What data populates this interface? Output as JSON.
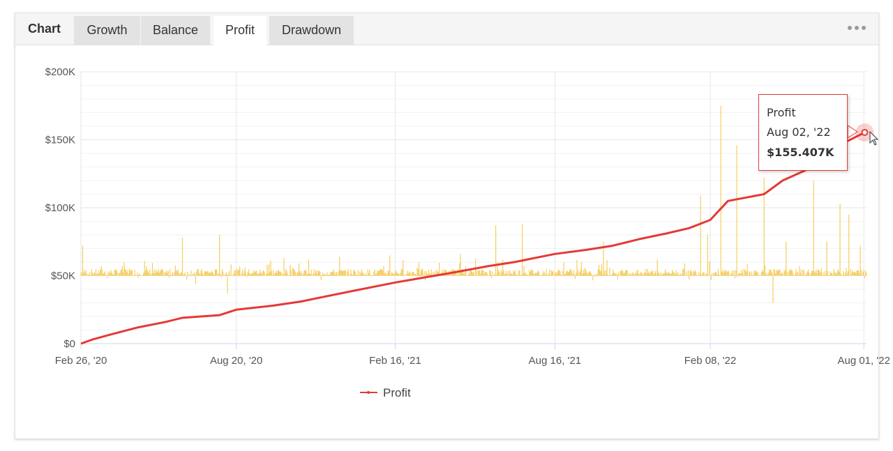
{
  "header": {
    "chart_label": "Chart",
    "tabs": [
      {
        "label": "Growth",
        "active": false
      },
      {
        "label": "Balance",
        "active": false
      },
      {
        "label": "Profit",
        "active": true
      },
      {
        "label": "Drawdown",
        "active": false
      }
    ],
    "menu_icon": "more-dots-icon"
  },
  "tooltip": {
    "series": "Profit",
    "date": "Aug 02, '22",
    "value": "$155.407K"
  },
  "colors": {
    "profit_line": "#e53935",
    "bars": "#f5cd5d",
    "grid": "#e6e6e6",
    "axis": "#ccd6eb",
    "tooltip_border": "#e53935"
  },
  "chart_data": {
    "type": "line",
    "y_tick_labels": [
      "$0",
      "$50K",
      "$100K",
      "$150K",
      "$200K"
    ],
    "x_tick_labels": [
      "Feb 26, '20",
      "Aug 20, '20",
      "Feb 16, '21",
      "Aug 16, '21",
      "Feb 08, '22",
      "Aug 01, '22"
    ],
    "x_range": [
      "2020-02-26",
      "2022-08-04"
    ],
    "ylim": [
      0,
      200000
    ],
    "grid": true,
    "legend": {
      "position": "bottom-center",
      "entries": [
        "Profit"
      ]
    },
    "series": [
      {
        "name": "Profit",
        "type": "line",
        "points": [
          [
            "2020-02-26",
            0
          ],
          [
            "2020-03-10",
            3000
          ],
          [
            "2020-04-01",
            7000
          ],
          [
            "2020-05-01",
            12000
          ],
          [
            "2020-06-01",
            16000
          ],
          [
            "2020-06-20",
            19000
          ],
          [
            "2020-08-01",
            21000
          ],
          [
            "2020-08-20",
            25000
          ],
          [
            "2020-10-01",
            28000
          ],
          [
            "2020-11-01",
            31000
          ],
          [
            "2020-12-01",
            35000
          ],
          [
            "2021-01-01",
            39000
          ],
          [
            "2021-02-16",
            45000
          ],
          [
            "2021-03-15",
            48000
          ],
          [
            "2021-04-20",
            52000
          ],
          [
            "2021-06-01",
            57000
          ],
          [
            "2021-07-01",
            60000
          ],
          [
            "2021-08-16",
            66000
          ],
          [
            "2021-09-20",
            69000
          ],
          [
            "2021-10-20",
            72000
          ],
          [
            "2021-11-20",
            77000
          ],
          [
            "2021-12-20",
            81000
          ],
          [
            "2022-01-15",
            85000
          ],
          [
            "2022-02-08",
            91000
          ],
          [
            "2022-02-28",
            105000
          ],
          [
            "2022-04-10",
            110000
          ],
          [
            "2022-05-01",
            120000
          ],
          [
            "2022-06-01",
            129000
          ],
          [
            "2022-07-01",
            145000
          ],
          [
            "2022-08-02",
            155407
          ]
        ]
      },
      {
        "name": "",
        "type": "bar",
        "baseline": 50000,
        "points": [
          [
            "2020-02-28",
            72000
          ],
          [
            "2020-03-20",
            57000
          ],
          [
            "2020-04-15",
            60000
          ],
          [
            "2020-05-10",
            57000
          ],
          [
            "2020-06-20",
            78000
          ],
          [
            "2020-07-05",
            44000
          ],
          [
            "2020-08-01",
            80000
          ],
          [
            "2020-08-10",
            37000
          ],
          [
            "2020-10-20",
            58000
          ],
          [
            "2020-11-10",
            62000
          ],
          [
            "2020-12-15",
            64000
          ],
          [
            "2021-02-10",
            65000
          ],
          [
            "2021-03-15",
            60000
          ],
          [
            "2021-05-01",
            66000
          ],
          [
            "2021-06-10",
            87000
          ],
          [
            "2021-07-10",
            88000
          ],
          [
            "2021-09-15",
            60000
          ],
          [
            "2021-10-05",
            58000
          ],
          [
            "2021-10-10",
            75000
          ],
          [
            "2021-12-10",
            62000
          ],
          [
            "2022-01-10",
            59000
          ],
          [
            "2022-01-28",
            109000
          ],
          [
            "2022-02-05",
            80000
          ],
          [
            "2022-02-20",
            175000
          ],
          [
            "2022-03-10",
            146000
          ],
          [
            "2022-04-10",
            122000
          ],
          [
            "2022-04-20",
            30000
          ],
          [
            "2022-05-05",
            75000
          ],
          [
            "2022-06-05",
            120000
          ],
          [
            "2022-06-20",
            75000
          ],
          [
            "2022-07-05",
            103000
          ],
          [
            "2022-07-15",
            95000
          ],
          [
            "2022-07-28",
            72000
          ]
        ]
      }
    ],
    "tooltip_point": [
      "2022-08-02",
      155407
    ]
  }
}
